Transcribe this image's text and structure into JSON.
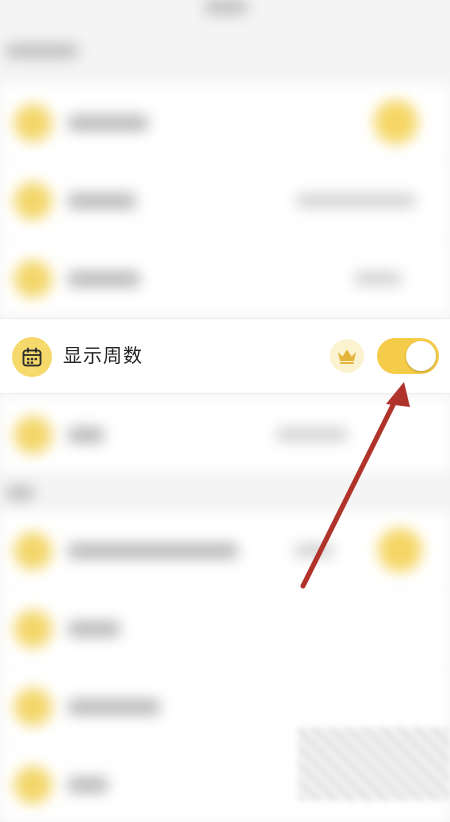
{
  "setting": {
    "label": "显示周数",
    "icon": "calendar-icon",
    "premium_icon": "crown-icon",
    "toggle_on": true
  },
  "colors": {
    "accent": "#f4cc4a",
    "icon_bg": "#f6d96b",
    "premium_bg": "#fbf2cf",
    "annotation_arrow": "#b0332b",
    "background": "#f4f4f4"
  }
}
